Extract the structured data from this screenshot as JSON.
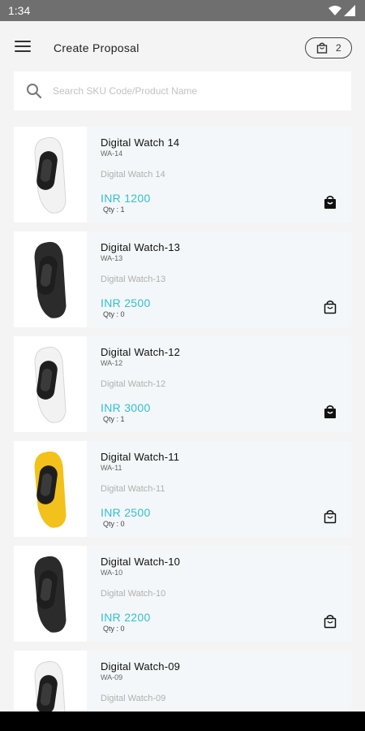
{
  "status_bar": {
    "time": "1:34"
  },
  "header": {
    "title": "Create Proposal",
    "cart_count": "2"
  },
  "search": {
    "placeholder": "Search SKU Code/Product Name"
  },
  "products": [
    {
      "name": "Digital Watch 14",
      "sku": "WA-14",
      "description": "Digital Watch 14",
      "price": "INR 1200",
      "qty": "Qty : 1",
      "in_cart": true,
      "strap_color": "#f2f2f2"
    },
    {
      "name": "Digital Watch-13",
      "sku": "WA-13",
      "description": "Digital Watch-13",
      "price": "INR 2500",
      "qty": "Qty : 0",
      "in_cart": false,
      "strap_color": "#2b2b2b"
    },
    {
      "name": "Digital Watch-12",
      "sku": "WA-12",
      "description": "Digital Watch-12",
      "price": "INR 3000",
      "qty": "Qty : 1",
      "in_cart": true,
      "strap_color": "#f2f2f2"
    },
    {
      "name": "Digital Watch-11",
      "sku": "WA-11",
      "description": "Digital Watch-11",
      "price": "INR 2500",
      "qty": "Qty : 0",
      "in_cart": false,
      "strap_color": "#f2c11b"
    },
    {
      "name": "Digital Watch-10",
      "sku": "WA-10",
      "description": "Digital Watch-10",
      "price": "INR 2200",
      "qty": "Qty : 0",
      "in_cart": false,
      "strap_color": "#2b2b2b"
    },
    {
      "name": "Digital Watch-09",
      "sku": "WA-09",
      "description": "Digital Watch-09",
      "price": "",
      "qty": "",
      "in_cart": false,
      "strap_color": "#f2f2f2"
    }
  ],
  "colors": {
    "accent": "#33bfd2",
    "card_bg": "#f3f7f9",
    "page_bg": "#f4f4f4",
    "status_bar": "#6f6f6f"
  },
  "icons": {
    "menu": "hamburger-icon",
    "cart": "shopping-bag-icon",
    "search": "search-icon"
  }
}
